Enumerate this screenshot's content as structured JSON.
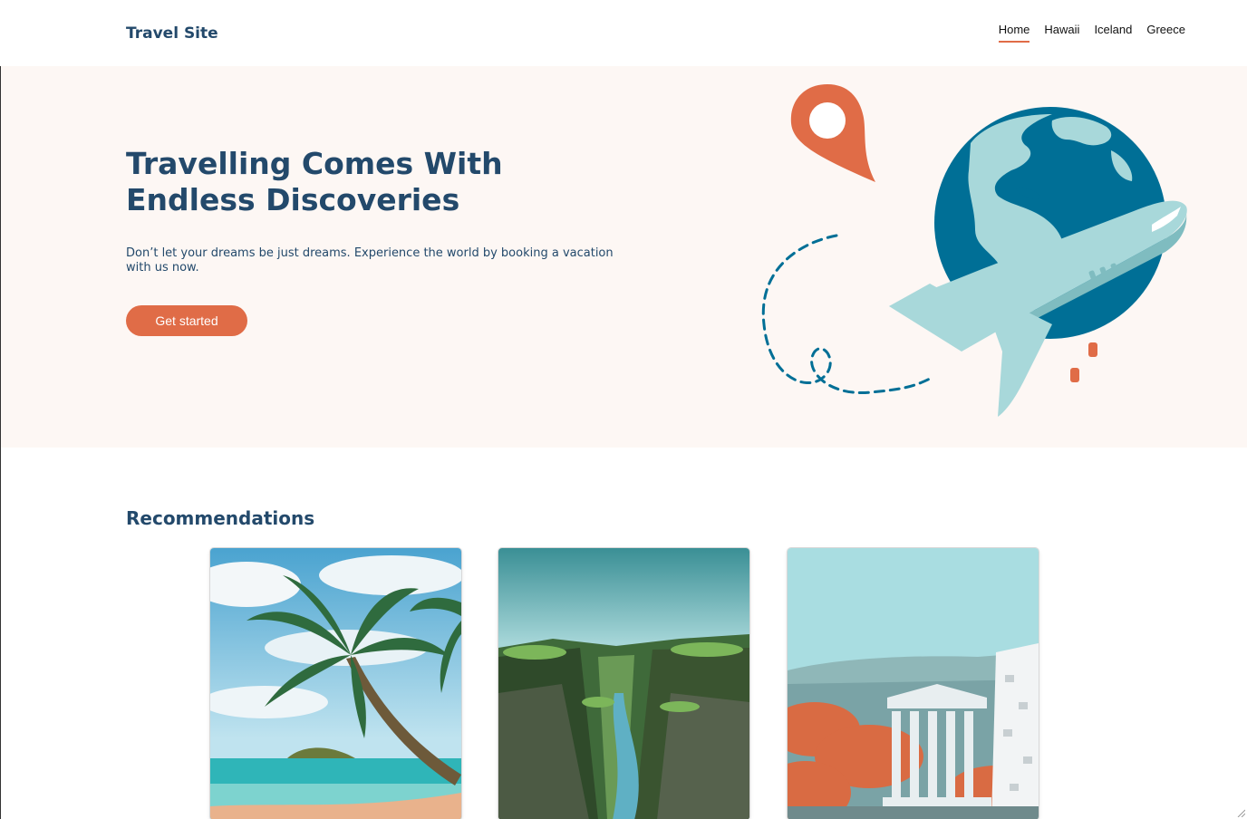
{
  "header": {
    "brand": "Travel Site",
    "nav": [
      {
        "label": "Home",
        "active": true
      },
      {
        "label": "Hawaii",
        "active": false
      },
      {
        "label": "Iceland",
        "active": false
      },
      {
        "label": "Greece",
        "active": false
      }
    ]
  },
  "hero": {
    "title": "Travelling Comes With Endless Discoveries",
    "text": "Don’t let your dreams be just dreams. Experience the world by booking a vacation with us now.",
    "cta_label": "Get started"
  },
  "recommendations": {
    "title": "Recommendations",
    "cards": [
      {
        "image": "palm-beach-photo"
      },
      {
        "image": "green-canyon-photo"
      },
      {
        "image": "greek-temple-photo"
      }
    ]
  },
  "colors": {
    "primary_text": "#23496b",
    "accent": "#e06c47",
    "hero_bg": "#fdf7f4",
    "globe_ocean": "#006f96",
    "globe_land": "#a8d8da"
  },
  "icons": {
    "hero_illustration": "globe-plane-pin-illustration"
  }
}
